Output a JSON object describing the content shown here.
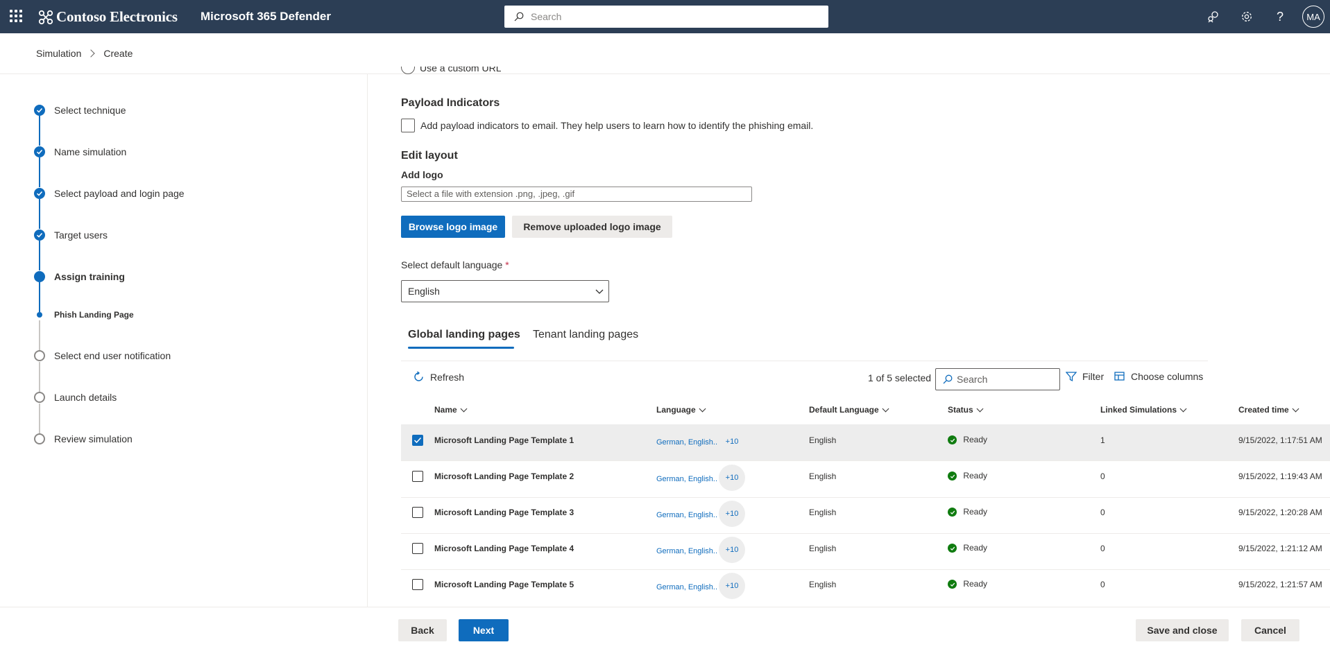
{
  "header": {
    "org_name": "Contoso Electronics",
    "app_title": "Microsoft 365 Defender",
    "search_placeholder": "Search",
    "avatar_initials": "MA"
  },
  "breadcrumb": [
    "Simulation",
    "Create"
  ],
  "steps": [
    {
      "label": "Select technique",
      "state": "done"
    },
    {
      "label": "Name simulation",
      "state": "done"
    },
    {
      "label": "Select payload and login page",
      "state": "done"
    },
    {
      "label": "Target users",
      "state": "done"
    },
    {
      "label": "Assign training",
      "state": "current"
    },
    {
      "label": "Phish Landing Page",
      "state": "sub-current"
    },
    {
      "label": "Select end user notification",
      "state": "todo"
    },
    {
      "label": "Launch details",
      "state": "todo"
    },
    {
      "label": "Review simulation",
      "state": "todo"
    }
  ],
  "form": {
    "custom_url_label": "Use a custom URL",
    "payload_indicators_heading": "Payload Indicators",
    "payload_indicators_checkbox": "Add payload indicators to email. They help users to learn how to identify the phishing email.",
    "edit_layout_heading": "Edit layout",
    "add_logo_label": "Add logo",
    "logo_file_placeholder": "Select a file with extension .png, .jpeg, .gif",
    "browse_logo_button": "Browse logo image",
    "remove_logo_button": "Remove uploaded logo image",
    "default_language_label": "Select default language",
    "required_marker": "*",
    "default_language_value": "English"
  },
  "tabs": [
    {
      "label": "Global landing pages",
      "active": true
    },
    {
      "label": "Tenant landing pages",
      "active": false
    }
  ],
  "toolbar": {
    "refresh": "Refresh",
    "selection_count": "1 of 5 selected",
    "search_placeholder": "Search",
    "filter": "Filter",
    "choose_columns": "Choose columns"
  },
  "table": {
    "columns": [
      "Name",
      "Language",
      "Default Language",
      "Status",
      "Linked Simulations",
      "Created time"
    ],
    "rows": [
      {
        "selected": true,
        "name": "Microsoft Landing Page Template 1",
        "language": "German, English..",
        "more": "+10",
        "default_language": "English",
        "status": "Ready",
        "linked": "1",
        "created": "9/15/2022, 1:17:51 AM"
      },
      {
        "selected": false,
        "name": "Microsoft Landing Page Template 2",
        "language": "German, English..",
        "more": "+10",
        "default_language": "English",
        "status": "Ready",
        "linked": "0",
        "created": "9/15/2022, 1:19:43 AM"
      },
      {
        "selected": false,
        "name": "Microsoft Landing Page Template 3",
        "language": "German, English..",
        "more": "+10",
        "default_language": "English",
        "status": "Ready",
        "linked": "0",
        "created": "9/15/2022, 1:20:28 AM"
      },
      {
        "selected": false,
        "name": "Microsoft Landing Page Template 4",
        "language": "German, English..",
        "more": "+10",
        "default_language": "English",
        "status": "Ready",
        "linked": "0",
        "created": "9/15/2022, 1:21:12 AM"
      },
      {
        "selected": false,
        "name": "Microsoft Landing Page Template 5",
        "language": "German, English..",
        "more": "+10",
        "default_language": "English",
        "status": "Ready",
        "linked": "0",
        "created": "9/15/2022, 1:21:57 AM"
      }
    ]
  },
  "footer": {
    "back": "Back",
    "next": "Next",
    "save_and_close": "Save and close",
    "cancel": "Cancel"
  },
  "colors": {
    "header_bg": "#2c3e55",
    "accent": "#0f6cbd",
    "status_ok": "#107c10"
  }
}
